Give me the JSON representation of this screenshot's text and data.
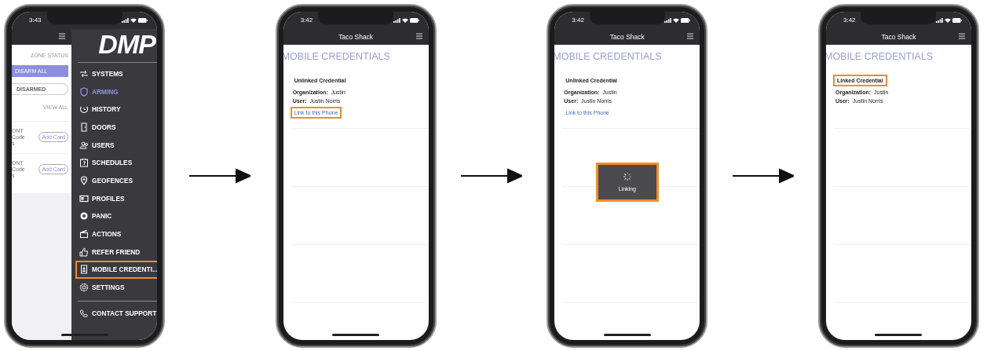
{
  "steps": [
    {
      "kind": "menu",
      "time": "3:43",
      "background": {
        "zone_status": "ZONE STATUS",
        "disarm_all": "DISARM ALL",
        "disarmed": "DISARMED",
        "view_all": "VIEW ALL",
        "cards": [
          {
            "lines": [
              "ONT",
              "Code",
              "s"
            ],
            "button": "Add Card"
          },
          {
            "lines": [
              "ONT",
              "Code",
              "s"
            ],
            "button": "Add Card"
          }
        ]
      },
      "logo": "DMP",
      "menu": [
        {
          "label": "SYSTEMS",
          "selected": false,
          "highlighted": false
        },
        {
          "label": "ARMING",
          "selected": true,
          "highlighted": false
        },
        {
          "label": "HISTORY",
          "selected": false,
          "highlighted": false
        },
        {
          "label": "DOORS",
          "selected": false,
          "highlighted": false
        },
        {
          "label": "USERS",
          "selected": false,
          "highlighted": false
        },
        {
          "label": "SCHEDULES",
          "selected": false,
          "highlighted": false
        },
        {
          "label": "GEOFENCES",
          "selected": false,
          "highlighted": false
        },
        {
          "label": "PROFILES",
          "selected": false,
          "highlighted": false
        },
        {
          "label": "PANIC",
          "selected": false,
          "highlighted": false
        },
        {
          "label": "ACTIONS",
          "selected": false,
          "highlighted": false
        },
        {
          "label": "REFER FRIEND",
          "selected": false,
          "highlighted": false
        },
        {
          "label": "MOBILE CREDENTI...",
          "selected": false,
          "highlighted": true
        },
        {
          "label": "SETTINGS",
          "selected": false,
          "highlighted": false
        },
        {
          "label": "CONTACT SUPPORT",
          "selected": false,
          "highlighted": false
        }
      ]
    },
    {
      "kind": "credentials",
      "time": "3:42",
      "title": "Taco Shack",
      "heading": "MOBILE CREDENTIALS",
      "credential": {
        "status": "Unlinked Credential",
        "status_highlighted": false,
        "organization_label": "Organization:",
        "organization": "Justin",
        "user_label": "User:",
        "user": "Justin Norris",
        "link": "Link to this Phone",
        "link_highlighted": true
      }
    },
    {
      "kind": "credentials",
      "time": "3:42",
      "title": "Taco Shack",
      "heading": "MOBILE CREDENTIALS",
      "credential": {
        "status": "Unlinked Credential",
        "status_highlighted": false,
        "organization_label": "Organization:",
        "organization": "Justin",
        "user_label": "User:",
        "user": "Justin Norris",
        "link": "Link to this Phone",
        "link_highlighted": false
      },
      "toast": {
        "text": "Linking",
        "highlighted": true
      }
    },
    {
      "kind": "credentials",
      "time": "3:42",
      "title": "Taco Shack",
      "heading": "MOBILE CREDENTIALS",
      "credential": {
        "status": "Linked Credential",
        "status_highlighted": true,
        "organization_label": "Organization:",
        "organization": "Justin",
        "user_label": "User:",
        "user": "Justin Norris"
      }
    }
  ]
}
